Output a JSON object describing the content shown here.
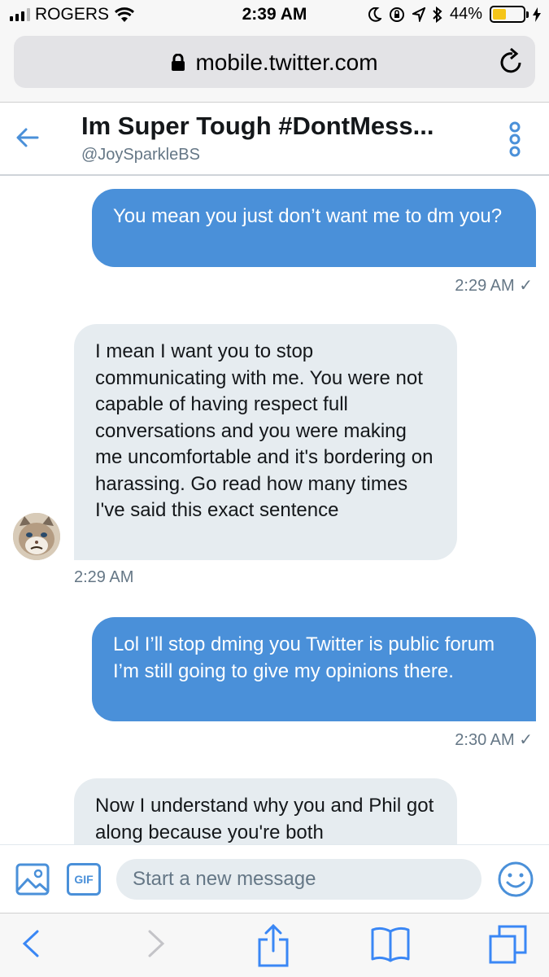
{
  "status_bar": {
    "carrier": "ROGERS",
    "time": "2:39 AM",
    "battery_percent": "44%",
    "battery_level": 0.44,
    "battery_color": "#f5c518",
    "icons": [
      "signal-icon",
      "wifi-icon",
      "moon-icon",
      "rotation-lock-icon",
      "location-icon",
      "bluetooth-icon",
      "battery-icon",
      "charging-icon"
    ]
  },
  "browser": {
    "url": "mobile.twitter.com",
    "icons": [
      "lock-icon",
      "reload-icon"
    ]
  },
  "conversation": {
    "title": "Im Super Tough #DontMess...",
    "handle": "@JoySparkleBS",
    "icons": [
      "back-arrow-icon",
      "more-options-icon"
    ]
  },
  "messages": [
    {
      "direction": "sent",
      "text": "You mean you just don’t want me to dm you?",
      "time": "2:29 AM ✓"
    },
    {
      "direction": "received",
      "text": "I mean I want you to stop communicating with me. You were not capable of having respect full conversations and you were making me uncomfortable and it's bordering on harassing. Go read how many times I've said this exact sentence",
      "time": "2:29 AM"
    },
    {
      "direction": "sent",
      "text": "Lol I’ll stop dming you Twitter is public forum I’m still going to give my opinions there.",
      "time": "2:30 AM ✓"
    },
    {
      "direction": "received",
      "text": "Now I understand why you and Phil got along because you're both",
      "time": ""
    }
  ],
  "compose": {
    "placeholder": "Start a new message",
    "gif_label": "GIF",
    "icons": [
      "image-icon",
      "emoji-icon"
    ]
  },
  "safari_toolbar": {
    "icons": [
      "back-icon",
      "forward-icon",
      "share-icon",
      "bookmarks-icon",
      "tabs-icon"
    ]
  },
  "colors": {
    "accent": "#4a90d9",
    "sent_bubble": "#4a90d9",
    "received_bubble": "#e6ecf0",
    "secondary_text": "#657786"
  }
}
